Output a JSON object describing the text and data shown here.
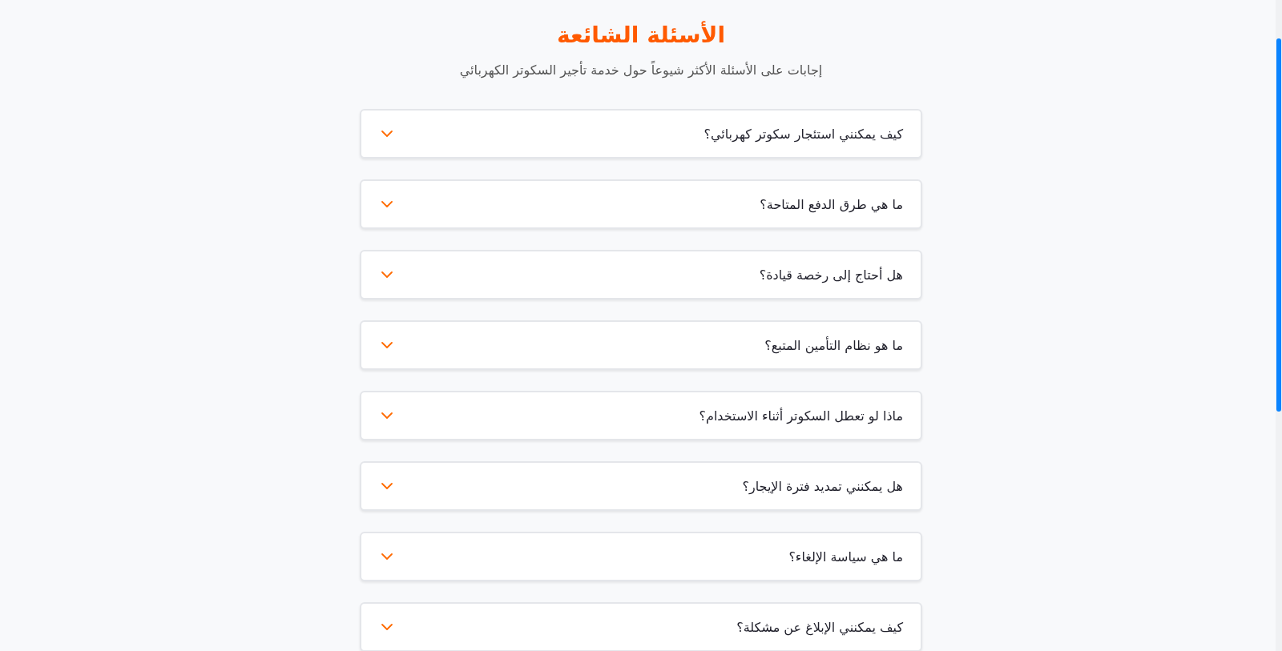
{
  "faq": {
    "title": "الأسئلة الشائعة",
    "subtitle": "إجابات على الأسئلة الأكثر شيوعاً حول خدمة تأجير السكوتر الكهربائي",
    "items": [
      {
        "question": "كيف يمكنني استئجار سكوتر كهربائي؟",
        "expanded": false
      },
      {
        "question": "ما هي طرق الدفع المتاحة؟",
        "expanded": false
      },
      {
        "question": "هل أحتاج إلى رخصة قيادة؟",
        "expanded": false
      },
      {
        "question": "ما هو نظام التأمين المتبع؟",
        "expanded": false
      },
      {
        "question": "ماذا لو تعطل السكوتر أثناء الاستخدام؟",
        "expanded": false
      },
      {
        "question": "هل يمكنني تمديد فترة الإيجار؟",
        "expanded": false
      },
      {
        "question": "ما هي سياسة الإلغاء؟",
        "expanded": false
      },
      {
        "question": "كيف يمكنني الإبلاغ عن مشكلة؟",
        "expanded": false
      }
    ]
  }
}
